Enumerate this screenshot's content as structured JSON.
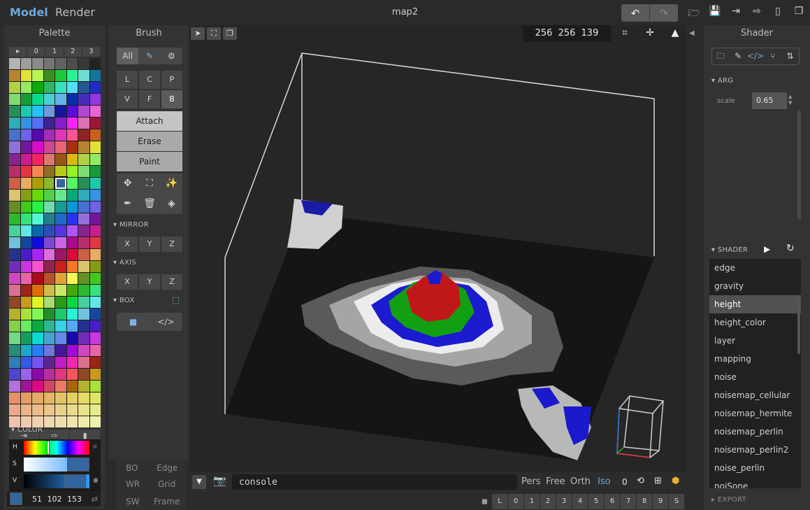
{
  "topbar": {
    "mode_model": "Model",
    "mode_render": "Render",
    "title": "map2",
    "undo_icon": "↶",
    "redo_icon": "↷",
    "icons": [
      "open-folder-icon",
      "save-icon",
      "import-icon",
      "export-icon",
      "new-file-icon",
      "duplicate-icon"
    ]
  },
  "palette": {
    "title": "Palette",
    "tabs": [
      "▸",
      "0",
      "1",
      "2",
      "3"
    ],
    "actions": [
      "⇥",
      "⇨",
      "▮"
    ],
    "section_color": "COLOR",
    "hsv_labels": [
      "H",
      "S",
      "V"
    ],
    "color_value": "51 102 153",
    "selected_color": "#336699",
    "swap_icon": "⇄"
  },
  "brush": {
    "title": "Brush",
    "top": {
      "all": "All",
      "brush_icon": "✎",
      "gear_icon": "⚙"
    },
    "shape_buttons": [
      "L",
      "C",
      "P",
      "V",
      "F",
      "B"
    ],
    "active_shape": "B",
    "modes": [
      "Attach",
      "Erase",
      "Paint"
    ],
    "active_mode": "Attach",
    "tool_icons": [
      "✥",
      "⛶",
      "✨",
      "✒",
      "🗑",
      "◈"
    ],
    "mirror": {
      "label": "MIRROR",
      "axes": [
        "X",
        "Y",
        "Z"
      ]
    },
    "axis": {
      "label": "AXIS",
      "axes": [
        "X",
        "Y",
        "Z"
      ]
    },
    "box": {
      "label": "BOX",
      "box_icon": "⬚",
      "square_icon": "■",
      "code_icon": "</>"
    }
  },
  "view_options": {
    "items": [
      "BO",
      "Edge",
      "WR",
      "Grid",
      "SW",
      "Frame"
    ]
  },
  "viewport": {
    "tools": [
      "➤",
      "⛶",
      "❐"
    ],
    "dimensions": "256 256 139",
    "right_icons": [
      "⌗",
      "✛",
      "▲"
    ]
  },
  "console": {
    "toggle": "▼",
    "camera_icon": "📷",
    "value": "console",
    "projections": [
      "Pers",
      "Free",
      "Orth",
      "Iso"
    ],
    "active_projection": "Iso",
    "zero": "0",
    "reset_icon": "⟲",
    "layout_icon": "⊞",
    "cube_icon": "⬢"
  },
  "layers": {
    "cam_icon": "◼",
    "keys": [
      "L",
      "0",
      "1",
      "2",
      "3",
      "4",
      "5",
      "6",
      "7",
      "8",
      "9",
      "S"
    ]
  },
  "shader": {
    "title": "Shader",
    "tabs": [
      "🗀",
      "✎",
      "</>",
      "⑂",
      "⇅"
    ],
    "active_tab": "</>",
    "arg_section": "ARG",
    "arg_name": "scale",
    "arg_value": "0.65",
    "shader_section": "SHADER",
    "play_icon": "▶",
    "reload_icon": "↻",
    "list": [
      "edge",
      "gravity",
      "height",
      "height_color",
      "layer",
      "mapping",
      "noise",
      "noisemap_cellular",
      "noisemap_hermite",
      "noisemap_perlin",
      "noisemap_perlin2",
      "noise_perlin",
      "noiSone"
    ],
    "selected": "height",
    "export_section": "EXPORT"
  }
}
